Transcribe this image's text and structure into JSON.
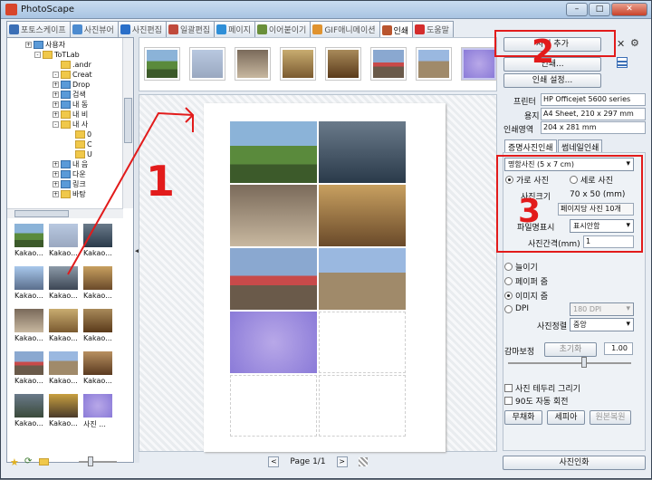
{
  "app": {
    "title": "PhotoScape"
  },
  "tabs": [
    {
      "label": "포토스케이프",
      "color": "#3b6fb6"
    },
    {
      "label": "사진뷰어",
      "color": "#4c8bd0"
    },
    {
      "label": "사진편집",
      "color": "#2a6fc9"
    },
    {
      "label": "일괄편집",
      "color": "#c04a3c"
    },
    {
      "label": "페이지",
      "color": "#2f8fd8"
    },
    {
      "label": "이어붙이기",
      "color": "#6a8f3a"
    },
    {
      "label": "GIF애니메이션",
      "color": "#e0932f"
    },
    {
      "label": "인쇄",
      "color": "#b9552f"
    },
    {
      "label": "도움말",
      "color": "#d42d2d"
    }
  ],
  "tree": {
    "items": [
      {
        "label": "사용자"
      },
      {
        "label": "ToTLab"
      },
      {
        "label": ".andr"
      },
      {
        "label": "Creat"
      },
      {
        "label": "Drop"
      },
      {
        "label": "검색"
      },
      {
        "label": "내 동"
      },
      {
        "label": "내 비"
      },
      {
        "label": "내 사"
      },
      {
        "label": "0"
      },
      {
        "label": "C"
      },
      {
        "label": "U"
      },
      {
        "label": "내 음"
      },
      {
        "label": "다운"
      },
      {
        "label": "링크"
      },
      {
        "label": "바탕"
      }
    ]
  },
  "thumbnails": [
    {
      "caption": "Kakao..."
    },
    {
      "caption": "Kakao..."
    },
    {
      "caption": "Kakao..."
    },
    {
      "caption": "Kakao..."
    },
    {
      "caption": "Kakao..."
    },
    {
      "caption": "Kakao..."
    },
    {
      "caption": "Kakao..."
    },
    {
      "caption": "Kakao..."
    },
    {
      "caption": "Kakao..."
    },
    {
      "caption": "Kakao..."
    },
    {
      "caption": "Kakao..."
    },
    {
      "caption": "Kakao..."
    },
    {
      "caption": "Kakao..."
    },
    {
      "caption": "Kakao..."
    },
    {
      "caption": "사진 ..."
    }
  ],
  "pager": {
    "label": "Page 1/1",
    "prev": "<",
    "next": ">"
  },
  "print_panel": {
    "add_photo": "사진 추가",
    "print": "인쇄...",
    "print_settings": "인쇄 설정...",
    "printer_label": "프린터",
    "printer_value": "HP Officejet 5600 series",
    "paper_label": "용지",
    "paper_value": "A4 Sheet, 210 x 297 mm",
    "print_area_label": "인쇄영역",
    "print_area_value": "204 x 281 mm",
    "subtab_id": "증명사진인쇄",
    "subtab_thumb": "썸네일인쇄",
    "size_select": "명함사진 (5 x 7 cm)",
    "landscape": "가로 사진",
    "portrait": "세로 사진",
    "photo_size_label": "사진크기",
    "photo_size_value": "70 x 50 (mm)",
    "per_page": "페이지당 사진 10개",
    "filename_label": "파일명표시",
    "filename_value": "표시안함",
    "spacing_label": "사진간격(mm)",
    "spacing_value": "1",
    "fit_stretch": "늘이기",
    "fit_paper": "페이퍼 줌",
    "fit_image": "이미지 줌",
    "dpi_label": "DPI",
    "dpi_value": "180 DPI",
    "align_label": "사진정렬",
    "align_value": "중앙",
    "gamma_label": "감마보정",
    "gamma_reset": "초기화",
    "gamma_value": "1.00",
    "border_check": "사진 테두리 그리기",
    "rotate_check": "90도 자동 회전",
    "mono_btn": "무채화",
    "sepia_btn": "세피아",
    "restore_btn": "원본복원",
    "print_photo_btn": "사진인화"
  },
  "annotations": [
    "1",
    "2",
    "3"
  ],
  "colors": {
    "accent_red": "#e21b1b"
  }
}
